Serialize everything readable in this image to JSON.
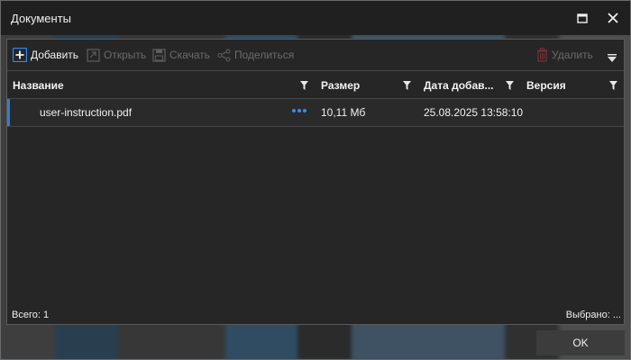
{
  "window": {
    "title": "Документы"
  },
  "toolbar": {
    "add": "Добавить",
    "open": "Открыть",
    "download": "Скачать",
    "share": "Поделиться",
    "delete": "Удалить"
  },
  "table": {
    "columns": [
      "Название",
      "Размер",
      "Дата добав...",
      "Версия"
    ],
    "rows": [
      {
        "name": "user-instruction.pdf",
        "size": "10,11 Мб",
        "date": "25.08.2025 13:58:10",
        "version": ""
      }
    ]
  },
  "footer": {
    "total": "Всего: 1",
    "selected": "Выбрано: ..."
  },
  "actions": {
    "ok": "OK"
  },
  "colors": {
    "accent": "#2d7fd1",
    "panel": "#262626",
    "titlebar": "#202020"
  }
}
